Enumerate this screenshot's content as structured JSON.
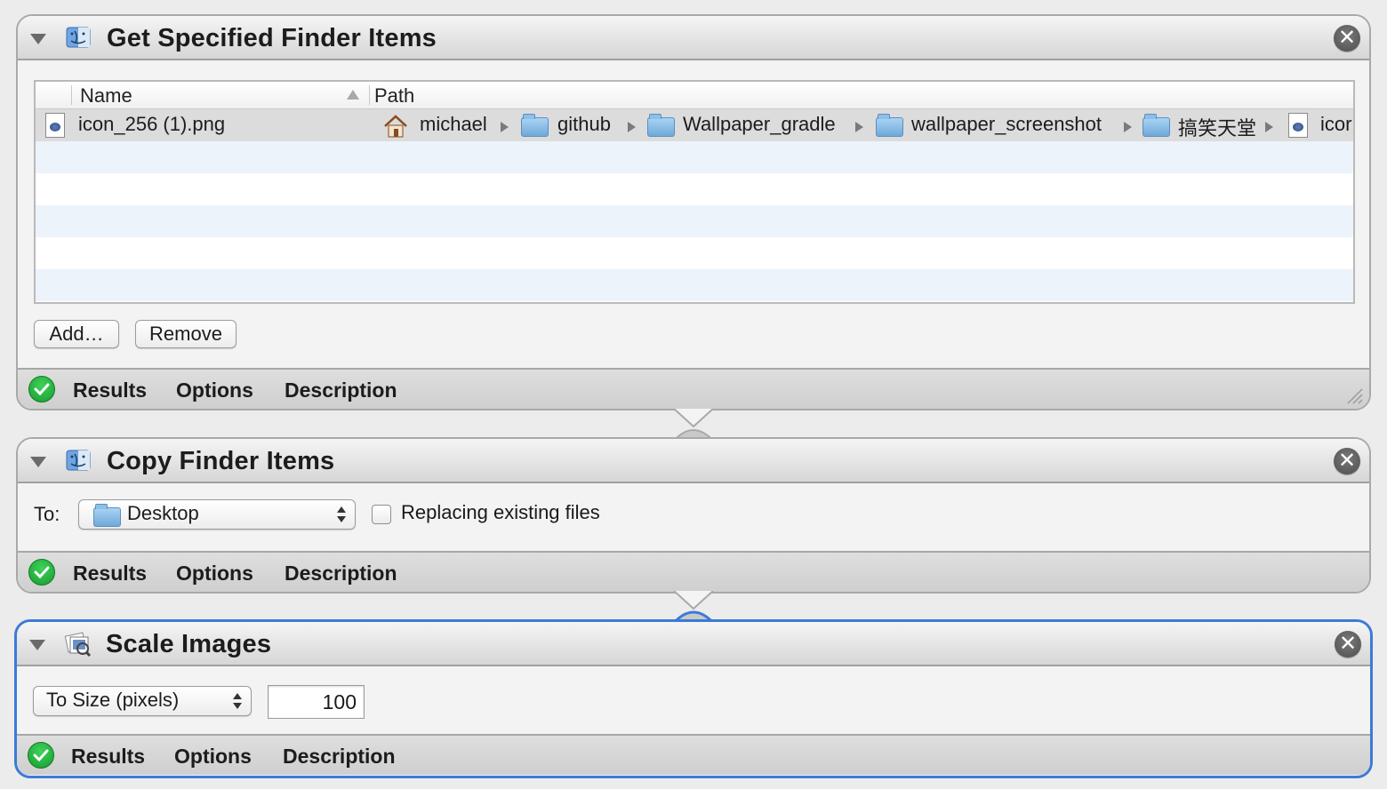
{
  "actions": [
    {
      "title": "Get Specified Finder Items",
      "table": {
        "columns": [
          "Name",
          "Path"
        ],
        "rows": [
          {
            "name": "icon_256 (1).png",
            "path": [
              "michael",
              "github",
              "Wallpaper_gradle",
              "wallpaper_screenshot",
              "搞笑天堂",
              "icor"
            ]
          }
        ]
      },
      "buttons": {
        "add": "Add…",
        "remove": "Remove"
      },
      "footer": {
        "results": "Results",
        "options": "Options",
        "description": "Description"
      }
    },
    {
      "title": "Copy Finder Items",
      "to_label": "To:",
      "destination": "Desktop",
      "replace_label": "Replacing existing files",
      "replace_checked": false,
      "footer": {
        "results": "Results",
        "options": "Options",
        "description": "Description"
      }
    },
    {
      "title": "Scale Images",
      "mode": "To Size (pixels)",
      "size_value": "100",
      "footer": {
        "results": "Results",
        "options": "Options",
        "description": "Description"
      }
    }
  ],
  "close_glyph": "✕",
  "colors": {
    "selection_border": "#3d7ad8",
    "success_green": "#22b23a"
  }
}
